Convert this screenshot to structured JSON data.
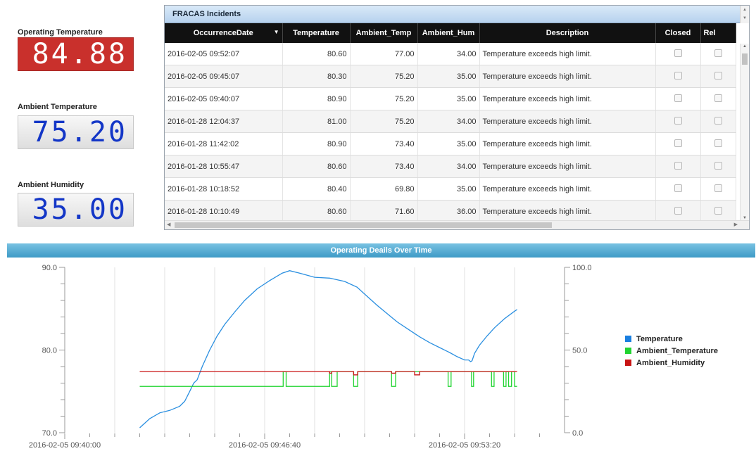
{
  "gauges": {
    "operating_temp": {
      "label": "Operating Temperature",
      "value": "84.88"
    },
    "ambient_temp": {
      "label": "Ambient Temperature",
      "value": "75.20"
    },
    "ambient_hum": {
      "label": "Ambient Humidity",
      "value": "35.00"
    }
  },
  "incidents": {
    "title": "FRACAS Incidents",
    "columns": [
      "OccurrenceDate",
      "Temperature",
      "Ambient_Temp",
      "Ambient_Hum",
      "Description",
      "Closed",
      "Rel"
    ],
    "rows": [
      {
        "date": "2016-02-05 09:52:07",
        "temp": "80.60",
        "amb_temp": "77.00",
        "amb_hum": "34.00",
        "desc": "Temperature exceeds high limit."
      },
      {
        "date": "2016-02-05 09:45:07",
        "temp": "80.30",
        "amb_temp": "75.20",
        "amb_hum": "35.00",
        "desc": "Temperature exceeds high limit."
      },
      {
        "date": "2016-02-05 09:40:07",
        "temp": "80.90",
        "amb_temp": "75.20",
        "amb_hum": "35.00",
        "desc": "Temperature exceeds high limit."
      },
      {
        "date": "2016-01-28 12:04:37",
        "temp": "81.00",
        "amb_temp": "75.20",
        "amb_hum": "34.00",
        "desc": "Temperature exceeds high limit."
      },
      {
        "date": "2016-01-28 11:42:02",
        "temp": "80.90",
        "amb_temp": "73.40",
        "amb_hum": "35.00",
        "desc": "Temperature exceeds high limit."
      },
      {
        "date": "2016-01-28 10:55:47",
        "temp": "80.60",
        "amb_temp": "73.40",
        "amb_hum": "34.00",
        "desc": "Temperature exceeds high limit."
      },
      {
        "date": "2016-01-28 10:18:52",
        "temp": "80.40",
        "amb_temp": "69.80",
        "amb_hum": "35.00",
        "desc": "Temperature exceeds high limit."
      },
      {
        "date": "2016-01-28 10:10:49",
        "temp": "80.60",
        "amb_temp": "71.60",
        "amb_hum": "36.00",
        "desc": "Temperature exceeds high limit."
      }
    ]
  },
  "chart_data": {
    "type": "line",
    "title": "Operating Deails Over Time",
    "x_tick_labels": [
      "2016-02-05 09:40:00",
      "2016-02-05 09:46:40",
      "2016-02-05 09:53:20"
    ],
    "left_axis": {
      "ylim": [
        70,
        90
      ],
      "tick_labels": [
        "90.0",
        "80.0",
        "70.0"
      ]
    },
    "right_axis": {
      "ylim": [
        0,
        100
      ],
      "tick_labels": [
        "100.0",
        "50.0",
        "0.0"
      ]
    },
    "legend_position": "right",
    "x_unit": "seconds after 2016-02-05 09:40:00",
    "series": [
      {
        "name": "Temperature",
        "axis": "left",
        "color": "#2a8fe0",
        "points": [
          [
            150,
            70.6
          ],
          [
            170,
            71.7
          ],
          [
            190,
            72.4
          ],
          [
            210,
            72.7
          ],
          [
            230,
            73.2
          ],
          [
            240,
            73.8
          ],
          [
            250,
            75.0
          ],
          [
            258,
            76.0
          ],
          [
            265,
            76.4
          ],
          [
            275,
            78.0
          ],
          [
            290,
            80.0
          ],
          [
            305,
            81.7
          ],
          [
            320,
            83.1
          ],
          [
            340,
            84.6
          ],
          [
            360,
            86.0
          ],
          [
            385,
            87.4
          ],
          [
            410,
            88.4
          ],
          [
            435,
            89.3
          ],
          [
            450,
            89.6
          ],
          [
            470,
            89.3
          ],
          [
            500,
            88.8
          ],
          [
            530,
            88.7
          ],
          [
            560,
            88.3
          ],
          [
            585,
            87.6
          ],
          [
            605,
            86.5
          ],
          [
            625,
            85.4
          ],
          [
            645,
            84.4
          ],
          [
            665,
            83.4
          ],
          [
            690,
            82.4
          ],
          [
            710,
            81.6
          ],
          [
            730,
            80.9
          ],
          [
            750,
            80.3
          ],
          [
            770,
            79.7
          ],
          [
            785,
            79.2
          ],
          [
            800,
            78.8
          ],
          [
            808,
            78.8
          ],
          [
            812,
            78.6
          ],
          [
            815,
            78.7
          ],
          [
            820,
            79.6
          ],
          [
            830,
            80.6
          ],
          [
            845,
            81.7
          ],
          [
            860,
            82.7
          ],
          [
            880,
            83.8
          ],
          [
            900,
            84.7
          ],
          [
            905,
            84.9
          ]
        ]
      },
      {
        "name": "Ambient_Temperature",
        "axis": "right",
        "color": "#21d431",
        "points": [
          [
            150,
            28
          ],
          [
            437,
            28
          ],
          [
            437,
            37
          ],
          [
            443,
            37
          ],
          [
            443,
            28
          ],
          [
            530,
            28
          ],
          [
            530,
            37
          ],
          [
            534,
            37
          ],
          [
            534,
            28
          ],
          [
            545,
            28
          ],
          [
            545,
            37
          ],
          [
            578,
            37
          ],
          [
            578,
            28
          ],
          [
            586,
            28
          ],
          [
            586,
            37
          ],
          [
            654,
            37
          ],
          [
            654,
            28
          ],
          [
            662,
            28
          ],
          [
            662,
            37
          ],
          [
            767,
            37
          ],
          [
            767,
            28
          ],
          [
            773,
            28
          ],
          [
            773,
            37
          ],
          [
            814,
            37
          ],
          [
            814,
            28
          ],
          [
            818,
            28
          ],
          [
            818,
            37
          ],
          [
            854,
            37
          ],
          [
            854,
            28
          ],
          [
            859,
            28
          ],
          [
            859,
            37
          ],
          [
            878,
            37
          ],
          [
            878,
            28
          ],
          [
            883,
            28
          ],
          [
            883,
            37
          ],
          [
            888,
            37
          ],
          [
            888,
            28
          ],
          [
            894,
            28
          ],
          [
            894,
            37
          ],
          [
            900,
            37
          ],
          [
            900,
            28
          ],
          [
            905,
            28
          ]
        ]
      },
      {
        "name": "Ambient_Humidity",
        "axis": "right",
        "color": "#c81414",
        "points": [
          [
            150,
            37
          ],
          [
            530,
            37
          ],
          [
            530,
            36
          ],
          [
            534,
            36
          ],
          [
            534,
            37
          ],
          [
            578,
            37
          ],
          [
            578,
            35
          ],
          [
            586,
            35
          ],
          [
            586,
            37
          ],
          [
            654,
            37
          ],
          [
            654,
            36
          ],
          [
            662,
            36
          ],
          [
            662,
            37
          ],
          [
            700,
            37
          ],
          [
            700,
            35
          ],
          [
            710,
            35
          ],
          [
            710,
            37
          ],
          [
            905,
            37
          ]
        ]
      }
    ]
  },
  "colors": {
    "gauge_red": "#c9302c",
    "gauge_digits_blue": "#1336c7",
    "header_blue": "#3e9ac6",
    "temperature": "#2a8fe0",
    "ambient_temperature": "#21d431",
    "ambient_humidity": "#c81414"
  }
}
